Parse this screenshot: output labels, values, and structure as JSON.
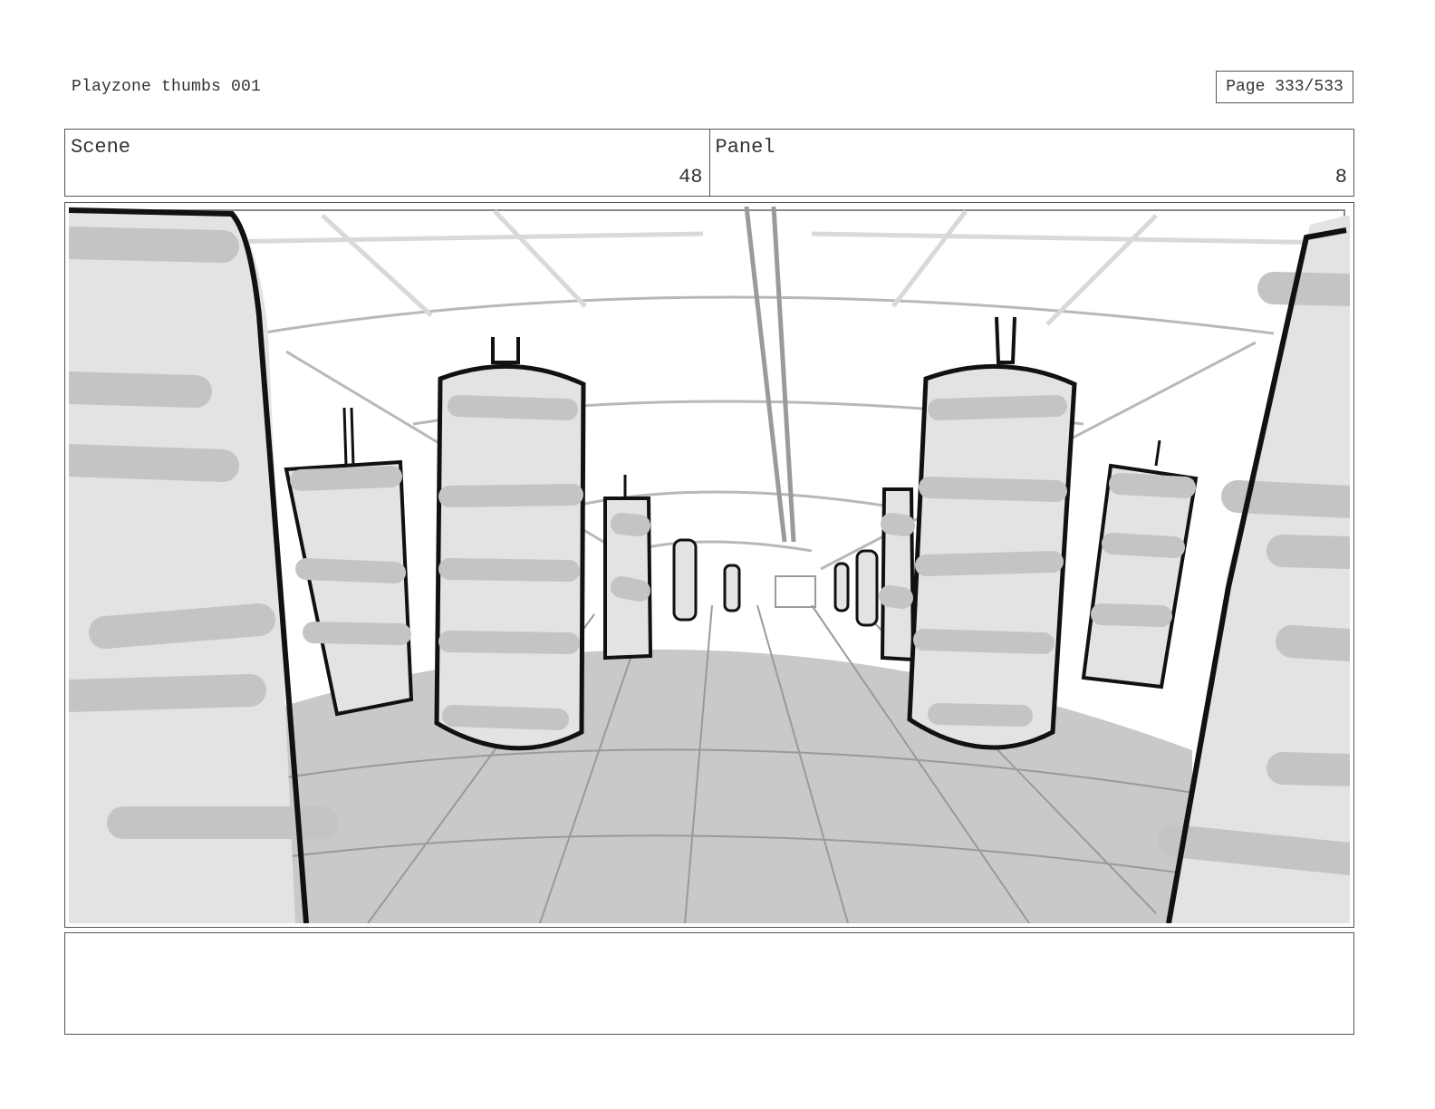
{
  "header": {
    "title": "Playzone thumbs 001",
    "page_label": "Page 333/533"
  },
  "info": {
    "scene_label": "Scene",
    "scene_value": "48",
    "panel_label": "Panel",
    "panel_value": "8"
  },
  "frame": {
    "colors": {
      "fill_light": "#e3e3e3",
      "fill_mid": "#c4c4c4",
      "stroke": "#111111",
      "guide": "#9a9a9a"
    }
  },
  "notes": {
    "text": ""
  }
}
